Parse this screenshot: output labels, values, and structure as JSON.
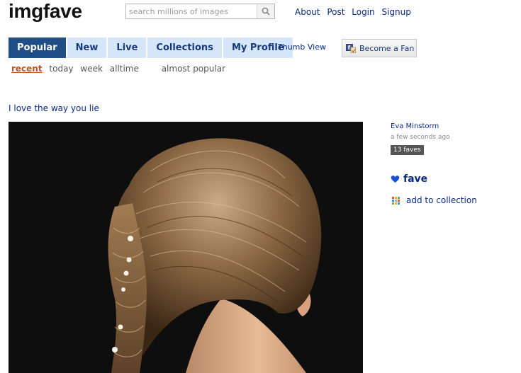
{
  "brand": {
    "logo": "imgfave"
  },
  "search": {
    "placeholder": "search millions of images"
  },
  "top_links": [
    "About",
    "Post",
    "Login",
    "Signup"
  ],
  "tabs": [
    {
      "label": "Popular",
      "active": true
    },
    {
      "label": "New",
      "active": false
    },
    {
      "label": "Live",
      "active": false
    },
    {
      "label": "Collections",
      "active": false
    },
    {
      "label": "My Profile",
      "active": false
    }
  ],
  "thumb_view": "Thumb View",
  "fan_button": {
    "label": "Become a Fan",
    "icon": "facebook-fan-icon"
  },
  "subnav": {
    "items": [
      "recent",
      "today",
      "week",
      "alltime"
    ],
    "selected": "recent",
    "extra": "almost popular"
  },
  "image": {
    "title": "I love the way you lie",
    "description_icon": "photo",
    "author": "Eva Minstorm",
    "posted": "a few seconds ago",
    "faves": "13 faves"
  },
  "actions": {
    "fave": "fave",
    "add_to_collection": "add to collection"
  },
  "colors": {
    "link": "#0a2a86",
    "tab_active": "#1f4d85",
    "tab_inactive": "#d4e6f8",
    "subnav_selected": "#c0561a"
  }
}
